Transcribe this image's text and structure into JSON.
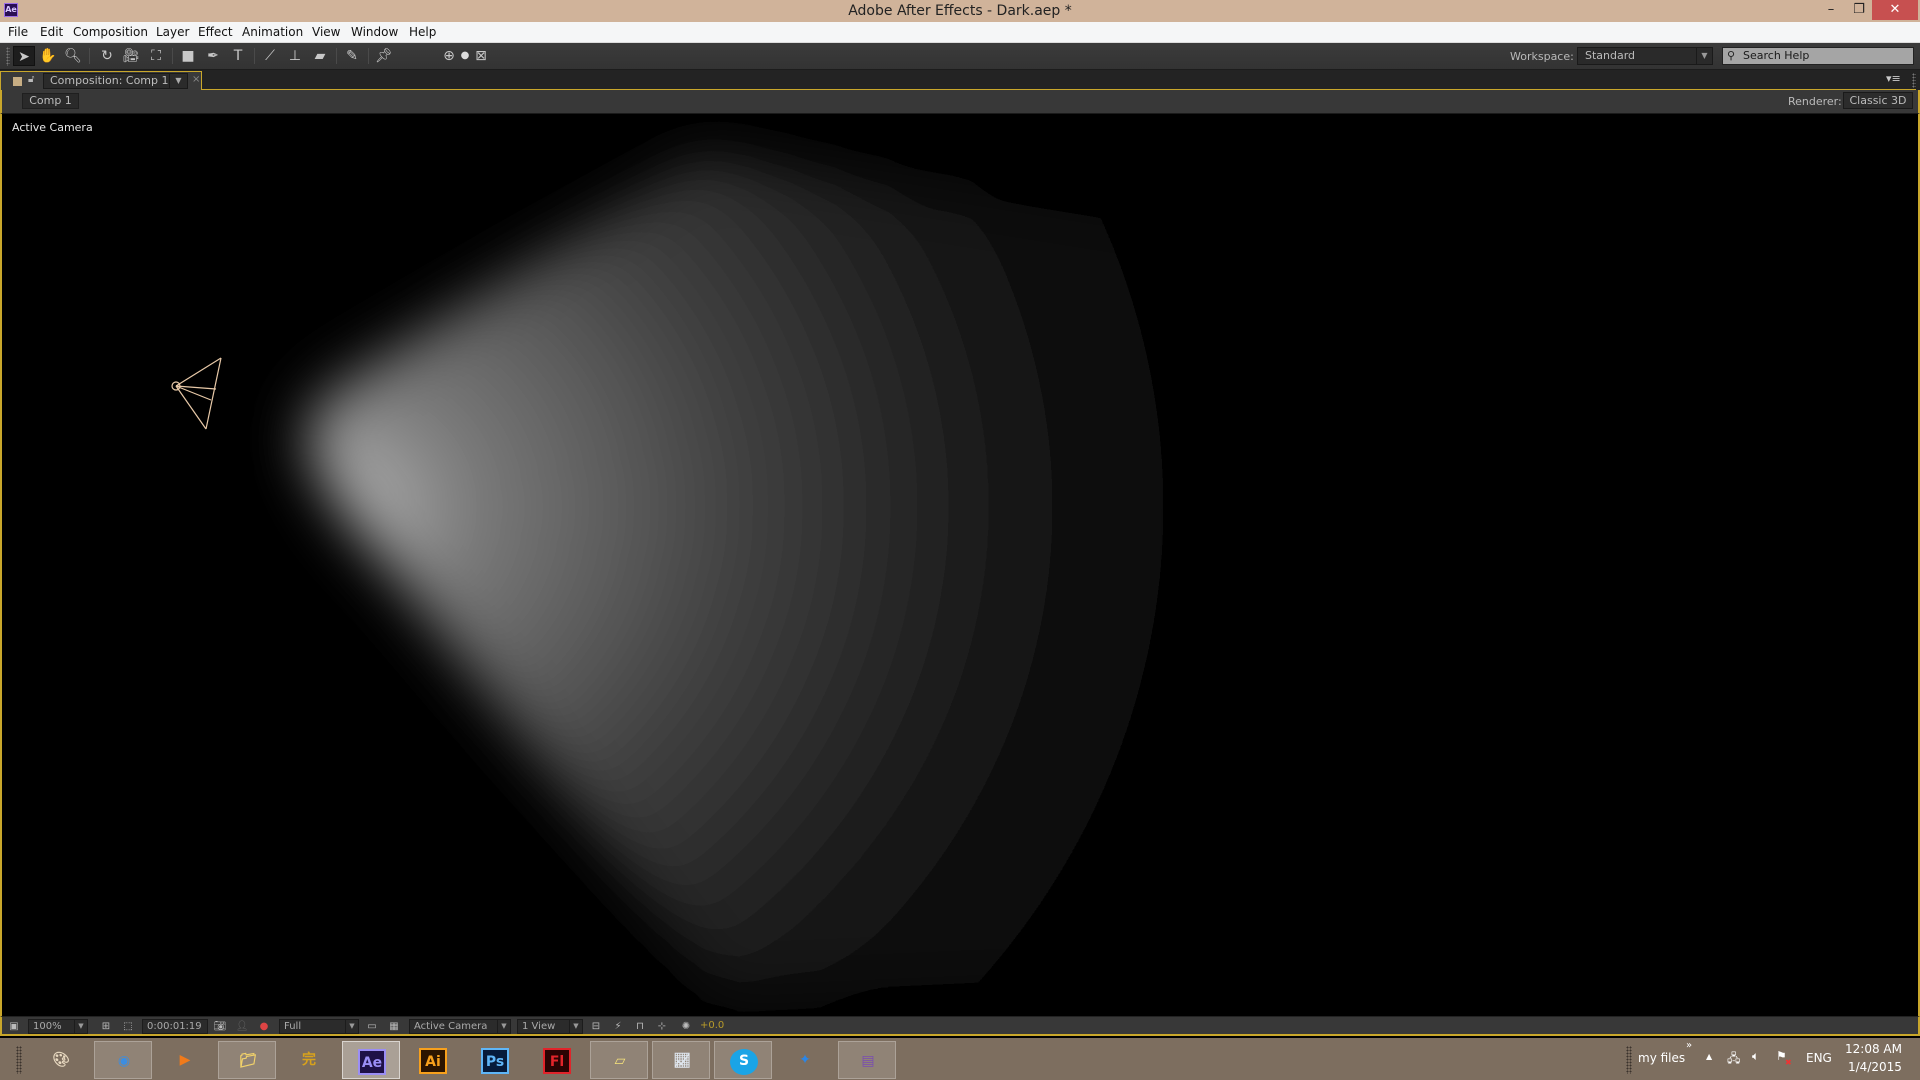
{
  "window": {
    "app_icon": "Ae",
    "title": "Adobe After Effects - Dark.aep *",
    "controls": {
      "minimize": "–",
      "maximize": "❐",
      "close": "✕"
    }
  },
  "menu": {
    "items": [
      {
        "label": "File"
      },
      {
        "label": "Edit"
      },
      {
        "label": "Composition"
      },
      {
        "label": "Layer"
      },
      {
        "label": "Effect"
      },
      {
        "label": "Animation"
      },
      {
        "label": "View"
      },
      {
        "label": "Window"
      },
      {
        "label": "Help"
      }
    ]
  },
  "toolbar": {
    "tools": [
      {
        "name": "selection-tool",
        "glyph": "➤",
        "active": true
      },
      {
        "name": "hand-tool",
        "glyph": "✋"
      },
      {
        "name": "zoom-tool",
        "glyph": "🔍︎"
      },
      {
        "name": "rotation-tool",
        "glyph": "↻"
      },
      {
        "name": "unified-camera-tool",
        "glyph": "🎥︎"
      },
      {
        "name": "pan-behind-tool",
        "glyph": "⛶"
      },
      {
        "name": "rectangle-tool",
        "glyph": "■"
      },
      {
        "name": "pen-tool",
        "glyph": "✒"
      },
      {
        "name": "type-tool",
        "glyph": "T"
      },
      {
        "name": "brush-tool",
        "glyph": "⟋"
      },
      {
        "name": "clone-stamp-tool",
        "glyph": "⊥"
      },
      {
        "name": "eraser-tool",
        "glyph": "▰"
      },
      {
        "name": "roto-brush-tool",
        "glyph": "✎"
      },
      {
        "name": "puppet-pin-tool",
        "glyph": "📌︎"
      },
      {
        "name": "local-axis-mode",
        "glyph": "⊕"
      },
      {
        "name": "world-axis-mode",
        "glyph": "●"
      },
      {
        "name": "view-axis-mode",
        "glyph": "⊠"
      }
    ],
    "workspace_label": "Workspace:",
    "workspace_value": "Standard",
    "search_placeholder": "Search Help"
  },
  "panel": {
    "tab_label": "Composition: Comp 1",
    "tab_close": "×",
    "panel_menu": "▾≡",
    "comp_button": "Comp 1",
    "renderer_label": "Renderer:",
    "renderer_value": "Classic 3D",
    "view_label": "Active Camera"
  },
  "viewer_bar": {
    "zoom": "100%",
    "timecode": "0:00:01:19",
    "resolution": "Full",
    "view": "Active Camera",
    "layout": "1 View",
    "exposure": "+0.0"
  },
  "taskbar": {
    "apps": [
      {
        "name": "paint",
        "glyph": "🎨︎",
        "color": "#e8d9c0",
        "state": "none"
      },
      {
        "name": "chrome",
        "glyph": "◉",
        "color": "#3c8de0",
        "state": "open"
      },
      {
        "name": "media-player",
        "glyph": "▶",
        "color": "#f07a1a",
        "state": "none"
      },
      {
        "name": "file-explorer",
        "glyph": "📁︎",
        "color": "#f2d26a",
        "state": "open"
      },
      {
        "name": "chinese-app",
        "glyph": "完",
        "color": "#d8a21c",
        "state": "none"
      },
      {
        "name": "after-effects",
        "glyph": "Ae",
        "color": "#9b8ef5",
        "state": "active"
      },
      {
        "name": "illustrator",
        "glyph": "Ai",
        "color": "#f7a01c",
        "state": "none"
      },
      {
        "name": "photoshop",
        "glyph": "Ps",
        "color": "#5fb6f7",
        "state": "none"
      },
      {
        "name": "flash",
        "glyph": "Fl",
        "color": "#e0242a",
        "state": "none"
      },
      {
        "name": "sticky-notes",
        "glyph": "▱",
        "color": "#f7e37a",
        "state": "open"
      },
      {
        "name": "resource-monitor",
        "glyph": "📈︎",
        "color": "#dfe6ee",
        "state": "open"
      },
      {
        "name": "skype",
        "glyph": "S",
        "color": "#1aa4e6",
        "state": "open"
      },
      {
        "name": "puzzle-app",
        "glyph": "✦",
        "color": "#2a86e8",
        "state": "none"
      },
      {
        "name": "winrar",
        "glyph": "▤",
        "color": "#7a4db0",
        "state": "open"
      }
    ],
    "tray": {
      "toolbar_label": "my files",
      "chevron": "»",
      "show_hidden": "▲",
      "language": "ENG",
      "time": "12:08 AM",
      "date": "1/4/2015"
    }
  }
}
